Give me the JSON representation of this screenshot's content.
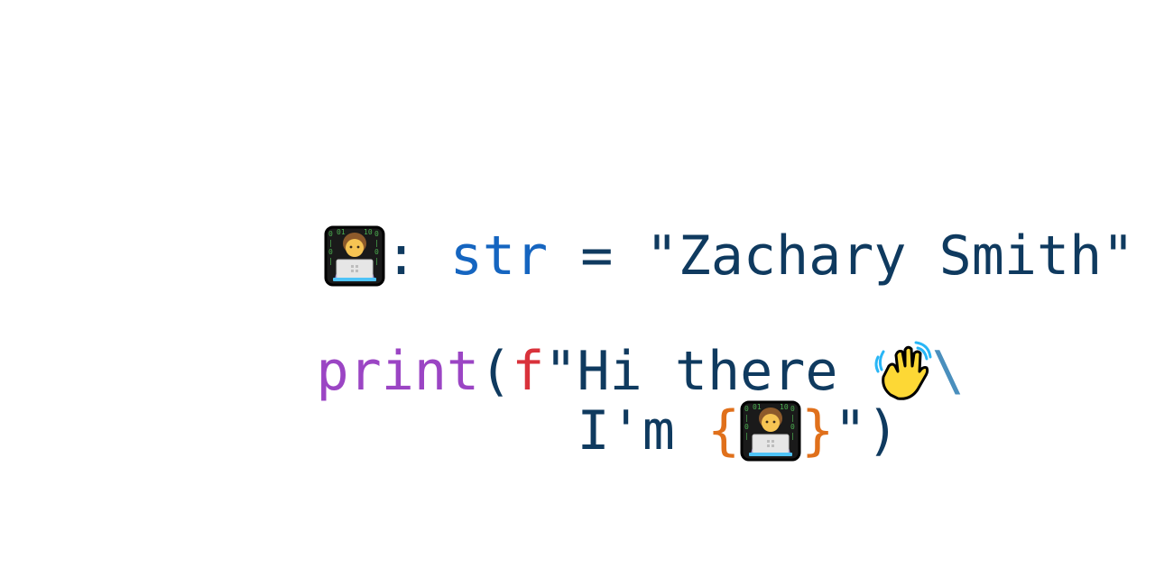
{
  "line1": {
    "icon": "technologist-icon",
    "colon": ":",
    "type": "str",
    "equals": "=",
    "value": "\"Zachary Smith\""
  },
  "line2": {
    "keyword": "print",
    "paren_open": "(",
    "prefix": "f",
    "string_start": "\"Hi there",
    "icon": "waving-hand-icon",
    "continuation": "\\"
  },
  "line3": {
    "string_text": "I'm",
    "brace_open": "{",
    "icon": "technologist-icon",
    "brace_close": "}",
    "closing": "\")"
  },
  "colors": {
    "default": "#0f3a5f",
    "type": "#1565c0",
    "keyword": "#9b45c4",
    "fprefix": "#d9323b",
    "brace": "#e0701b",
    "continuation": "#4a8fbd"
  }
}
